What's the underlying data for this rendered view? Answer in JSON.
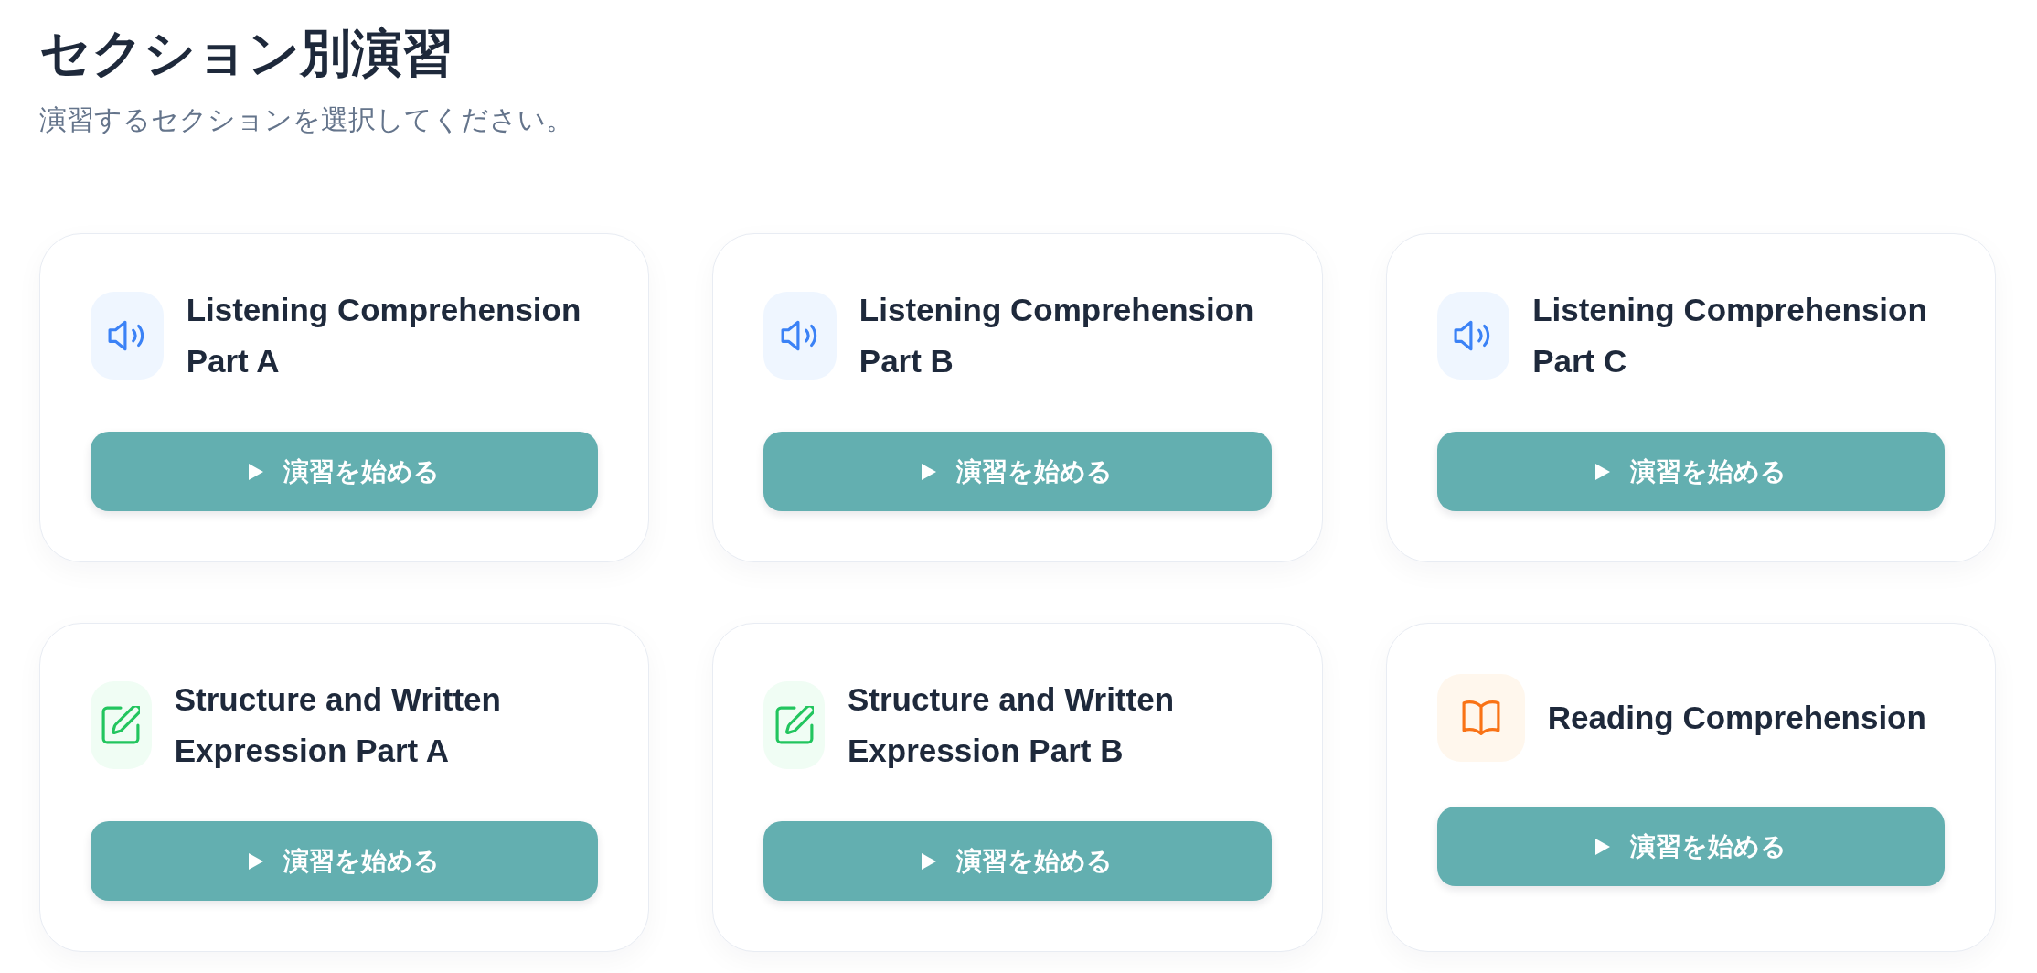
{
  "page": {
    "title": "セクション別演習",
    "subtitle": "演習するセクションを選択してください。"
  },
  "sections": [
    {
      "kind": "listening",
      "title": "Listening Comprehension Part A",
      "button": "演習を始める"
    },
    {
      "kind": "listening",
      "title": "Listening Comprehension Part B",
      "button": "演習を始める"
    },
    {
      "kind": "listening",
      "title": "Listening Comprehension Part C",
      "button": "演習を始める"
    },
    {
      "kind": "writing",
      "title": "Structure and Written Expression Part A",
      "button": "演習を始める"
    },
    {
      "kind": "writing",
      "title": "Structure and Written Expression Part B",
      "button": "演習を始める"
    },
    {
      "kind": "reading",
      "title": "Reading Comprehension",
      "button": "演習を始める"
    }
  ]
}
